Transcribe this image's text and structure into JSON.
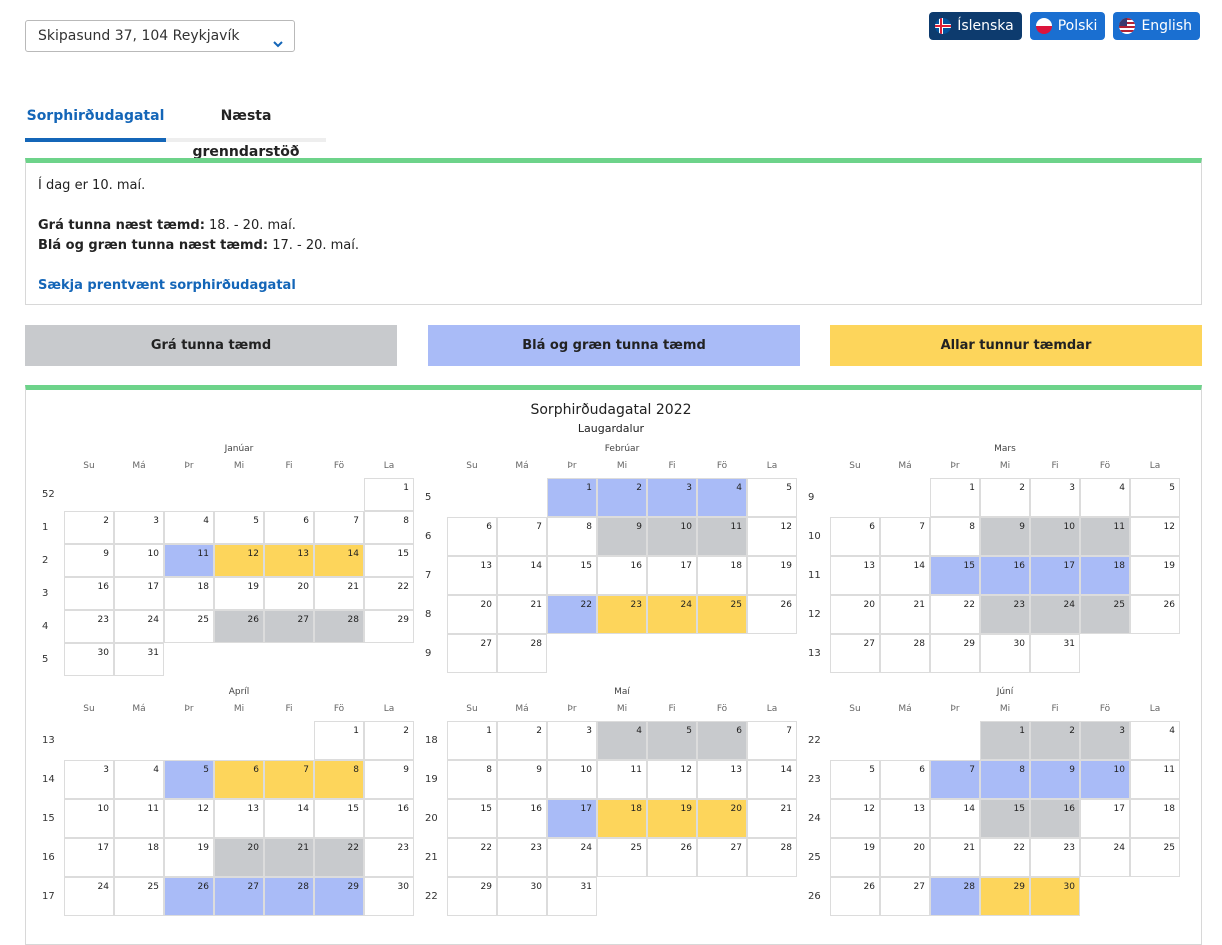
{
  "address": {
    "selected": "Skipasund 37, 104 Reykjavík"
  },
  "languages": [
    {
      "label": "Íslenska",
      "icon": "iceland-flag-icon"
    },
    {
      "label": "Polski",
      "icon": "poland-flag-icon"
    },
    {
      "label": "English",
      "icon": "usa-flag-icon"
    }
  ],
  "tabs": [
    {
      "label": "Sorphirðudagatal",
      "active": true
    },
    {
      "label": "Næsta grenndarstöð",
      "active": false
    }
  ],
  "info": {
    "today": "Í dag er 10. maí.",
    "grey_label": "Grá tunna næst tæmd:",
    "grey_value": " 18. - 20. maí.",
    "blue_label": "Blá og græn tunna næst tæmd:",
    "blue_value": " 17. - 20. maí.",
    "print_link": "Sækja prentvænt sorphirðudagatal"
  },
  "legend": {
    "grey": "Grá tunna tæmd",
    "blue": "Blá og græn tunna tæmd",
    "yellow": "Allar tunnur tæmdar"
  },
  "colors": {
    "grey": "#c8cacd",
    "blue": "#a9bbf7",
    "yellow": "#fdd55b",
    "accent": "#1466b8",
    "frame": "#6dd38a"
  },
  "calendar": {
    "title": "Sorphirðudagatal 2022",
    "subtitle": "Laugardalur",
    "weekdays": [
      "Su",
      "Má",
      "Þr",
      "Mi",
      "Fi",
      "Fö",
      "La"
    ],
    "months": [
      {
        "name": "Janúar",
        "weeks": [
          52,
          1,
          2,
          3,
          4,
          5
        ],
        "startCol": 6,
        "days": 31,
        "marks": {
          "11": "b",
          "12": "y",
          "13": "y",
          "14": "y",
          "26": "g",
          "27": "g",
          "28": "g"
        }
      },
      {
        "name": "Febrúar",
        "weeks": [
          5,
          6,
          7,
          8,
          9
        ],
        "startCol": 2,
        "days": 28,
        "marks": {
          "1": "b",
          "2": "b",
          "3": "b",
          "4": "b",
          "9": "g",
          "10": "g",
          "11": "g",
          "22": "b",
          "23": "y",
          "24": "y",
          "25": "y"
        }
      },
      {
        "name": "Mars",
        "weeks": [
          9,
          10,
          11,
          12,
          13
        ],
        "startCol": 2,
        "days": 31,
        "marks": {
          "9": "g",
          "10": "g",
          "11": "g",
          "15": "b",
          "16": "b",
          "17": "b",
          "18": "b",
          "23": "g",
          "24": "g",
          "25": "g"
        }
      },
      {
        "name": "Apríl",
        "weeks": [
          13,
          14,
          15,
          16,
          17
        ],
        "startCol": 5,
        "days": 30,
        "marks": {
          "5": "b",
          "6": "y",
          "7": "y",
          "8": "y",
          "20": "g",
          "21": "g",
          "22": "g",
          "26": "b",
          "27": "b",
          "28": "b",
          "29": "b"
        }
      },
      {
        "name": "Maí",
        "weeks": [
          18,
          19,
          20,
          21,
          22
        ],
        "startCol": 0,
        "days": 31,
        "marks": {
          "4": "g",
          "5": "g",
          "6": "g",
          "17": "b",
          "18": "y",
          "19": "y",
          "20": "y"
        }
      },
      {
        "name": "Júní",
        "weeks": [
          22,
          23,
          24,
          25,
          26
        ],
        "startCol": 3,
        "days": 30,
        "marks": {
          "1": "g",
          "2": "g",
          "3": "g",
          "7": "b",
          "8": "b",
          "9": "b",
          "10": "b",
          "15": "g",
          "16": "g",
          "28": "b",
          "29": "y",
          "30": "y"
        }
      }
    ]
  }
}
